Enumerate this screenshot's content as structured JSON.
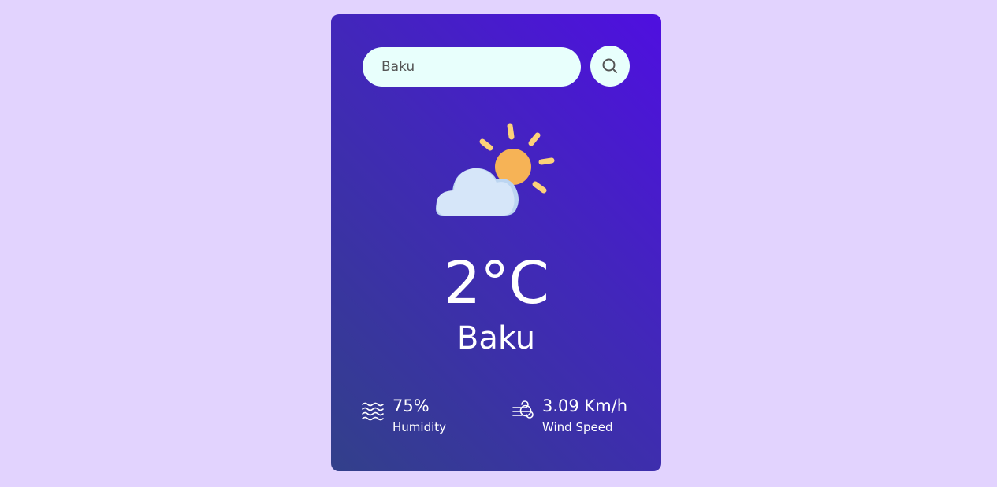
{
  "search": {
    "value": "Baku",
    "button_icon": "search-icon"
  },
  "weather": {
    "icon": "partly-cloudy-icon",
    "temperature": "2°C",
    "city": "Baku"
  },
  "details": {
    "humidity": {
      "icon": "humidity-waves-icon",
      "value": "75%",
      "label": "Humidity"
    },
    "wind": {
      "icon": "wind-icon",
      "value": "3.09 Km/h",
      "label": "Wind Speed"
    }
  },
  "colors": {
    "page_background": "#e2d3fe",
    "card_gradient_start": "#4f0fe0",
    "card_gradient_end": "#32408a",
    "input_background": "#e8fffc",
    "sun": "#f6b356",
    "sun_rays": "#fcd17a",
    "cloud": "#d6e6f9"
  }
}
